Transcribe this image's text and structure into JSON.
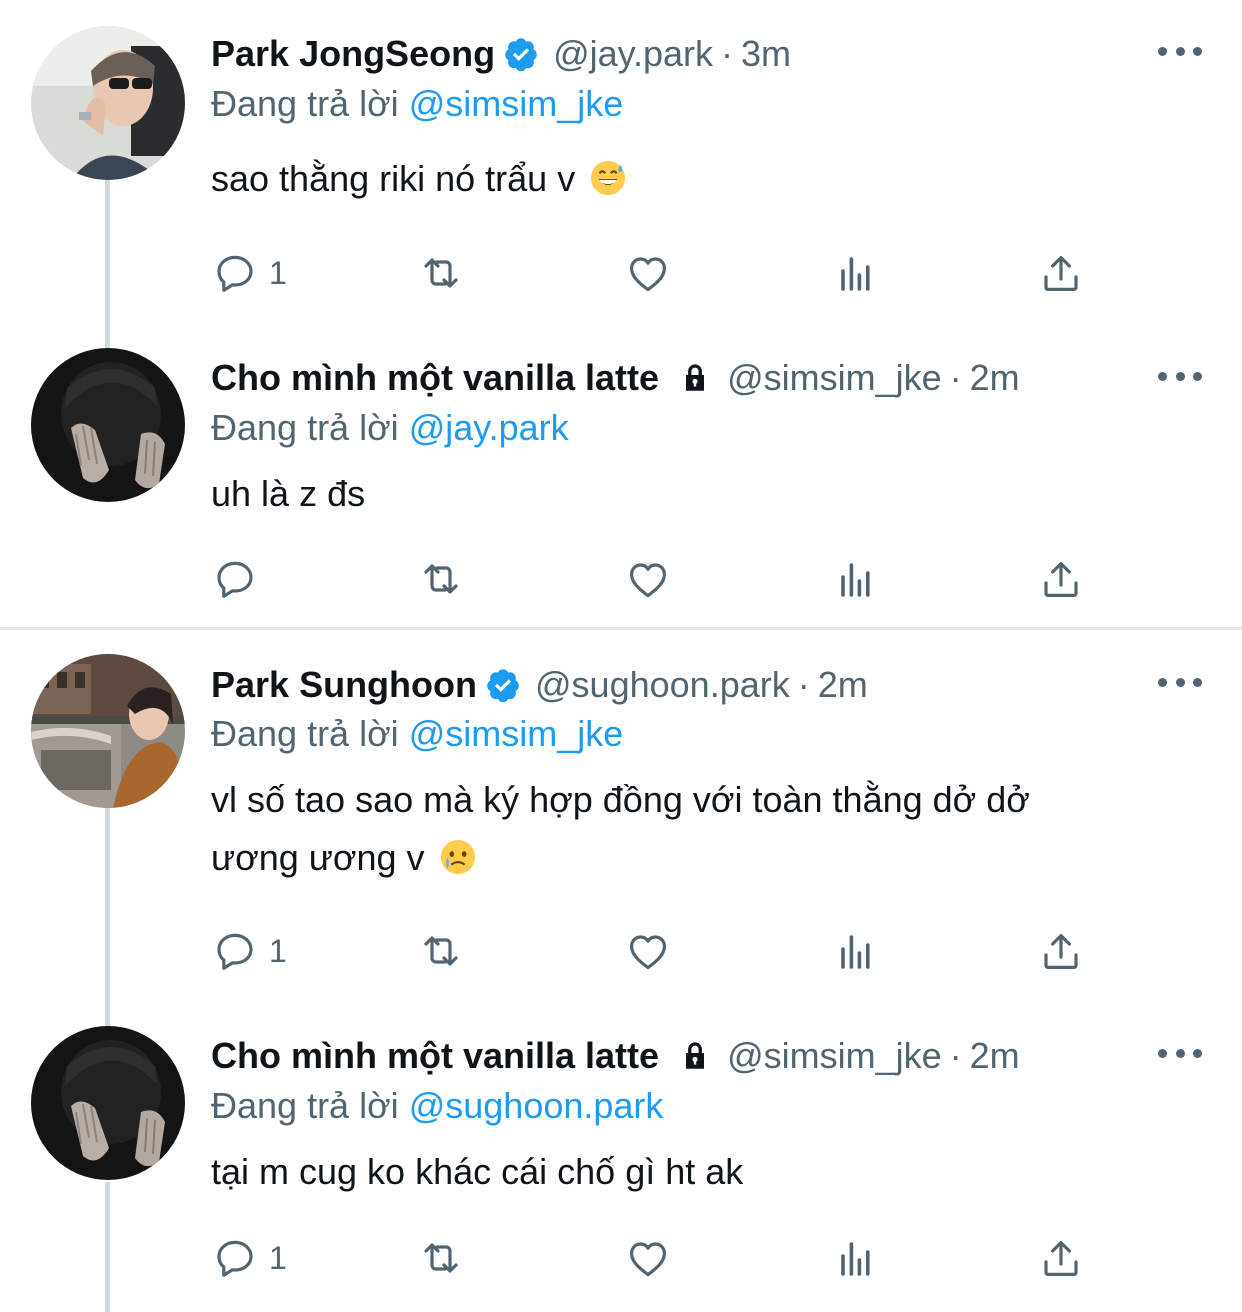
{
  "reply_prefix": "Đang trả lời",
  "tweets": [
    {
      "name": "Park JongSeong",
      "verified": true,
      "locked": false,
      "handle": "@jay.park",
      "sep": "·",
      "time": "3m",
      "replying_to": "@simsim_jke",
      "text": "sao thằng riki nó trẩu v",
      "emoji": "sweat-smile",
      "reply_count": "1",
      "avatar": "avatar-jongseong-photo"
    },
    {
      "name": "Cho mình một vanilla latte",
      "verified": false,
      "locked": true,
      "handle": "@simsim_jke",
      "sep": "·",
      "time": "2m",
      "replying_to": "@jay.park",
      "text": "uh là z đs",
      "emoji": "",
      "reply_count": "",
      "avatar": "avatar-hands-dark-photo"
    },
    {
      "name": "Park Sunghoon",
      "verified": true,
      "locked": false,
      "handle": "@sughoon.park",
      "sep": "·",
      "time": "2m",
      "replying_to": "@simsim_jke",
      "text_line1": "vl số tao sao mà ký hợp đồng với toàn thằng dở dở",
      "text_line2": "ương ương v",
      "emoji": "crying-face",
      "reply_count": "1",
      "avatar": "avatar-sunghoon-photo"
    },
    {
      "name": "Cho mình một vanilla latte",
      "verified": false,
      "locked": true,
      "handle": "@simsim_jke",
      "sep": "·",
      "time": "2m",
      "replying_to": "@sughoon.park",
      "text": "tại m cug ko khác cái chố gì ht ak",
      "emoji": "",
      "reply_count": "1",
      "avatar": "avatar-hands-dark-photo"
    }
  ],
  "colors": {
    "primary_text": "#0f1419",
    "secondary_text": "#536471",
    "link": "#1d9bf0",
    "thread_line": "#cfd9de",
    "divider": "#e5e7e9"
  }
}
